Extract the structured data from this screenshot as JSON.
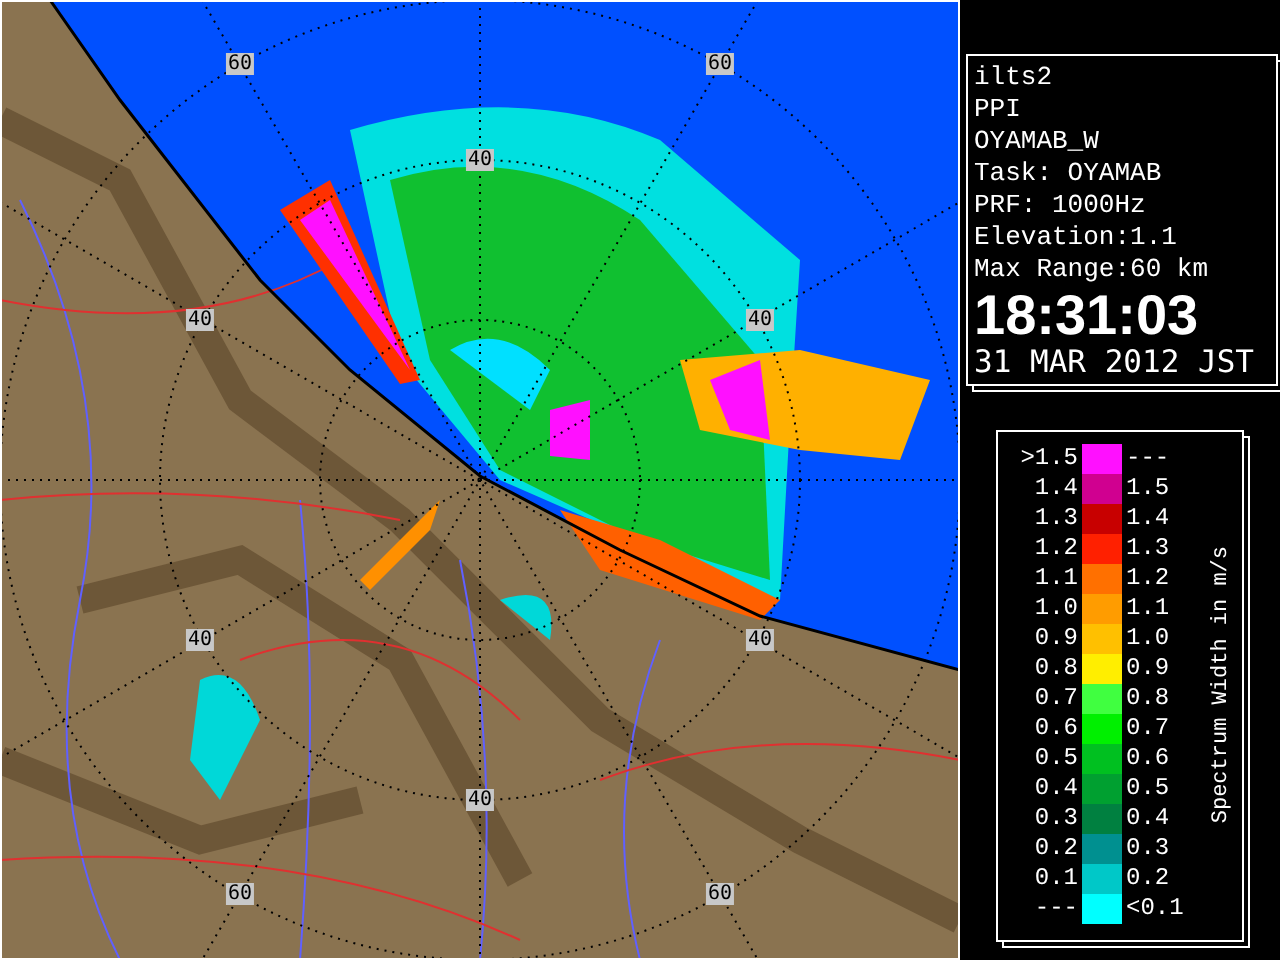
{
  "map": {
    "range_labels": [
      {
        "text": "60"
      },
      {
        "text": "60"
      },
      {
        "text": "40"
      },
      {
        "text": "40"
      },
      {
        "text": "40"
      },
      {
        "text": "40"
      },
      {
        "text": "40"
      },
      {
        "text": "40"
      },
      {
        "text": "60"
      },
      {
        "text": "60"
      }
    ]
  },
  "info": {
    "lines": [
      "ilts2",
      "PPI",
      "OYAMAB_W",
      "Task: OYAMAB",
      "PRF: 1000Hz",
      "Elevation:1.1",
      "Max Range:60 km"
    ],
    "time": "18:31:03",
    "date": "31 MAR 2012 JST"
  },
  "legend": {
    "title": "Spectrum Width in m/s",
    "rows": [
      {
        "low": ">1.5",
        "high": "---",
        "color": "#ff10ff"
      },
      {
        "low": "1.4",
        "high": "1.5",
        "color": "#d00090"
      },
      {
        "low": "1.3",
        "high": "1.4",
        "color": "#c80000"
      },
      {
        "low": "1.2",
        "high": "1.3",
        "color": "#ff2000"
      },
      {
        "low": "1.1",
        "high": "1.2",
        "color": "#ff7000"
      },
      {
        "low": "1.0",
        "high": "1.1",
        "color": "#ff9c00"
      },
      {
        "low": "0.9",
        "high": "1.0",
        "color": "#ffc000"
      },
      {
        "low": "0.8",
        "high": "0.9",
        "color": "#ffee00"
      },
      {
        "low": "0.7",
        "high": "0.8",
        "color": "#40ff40"
      },
      {
        "low": "0.6",
        "high": "0.7",
        "color": "#00f000"
      },
      {
        "low": "0.5",
        "high": "0.6",
        "color": "#00c020"
      },
      {
        "low": "0.4",
        "high": "0.5",
        "color": "#00a030"
      },
      {
        "low": "0.3",
        "high": "0.4",
        "color": "#008040"
      },
      {
        "low": "0.2",
        "high": "0.3",
        "color": "#009090"
      },
      {
        "low": "0.1",
        "high": "0.2",
        "color": "#00c8c8"
      },
      {
        "low": "---",
        "high": "<0.1",
        "color": "#00ffff"
      }
    ]
  }
}
